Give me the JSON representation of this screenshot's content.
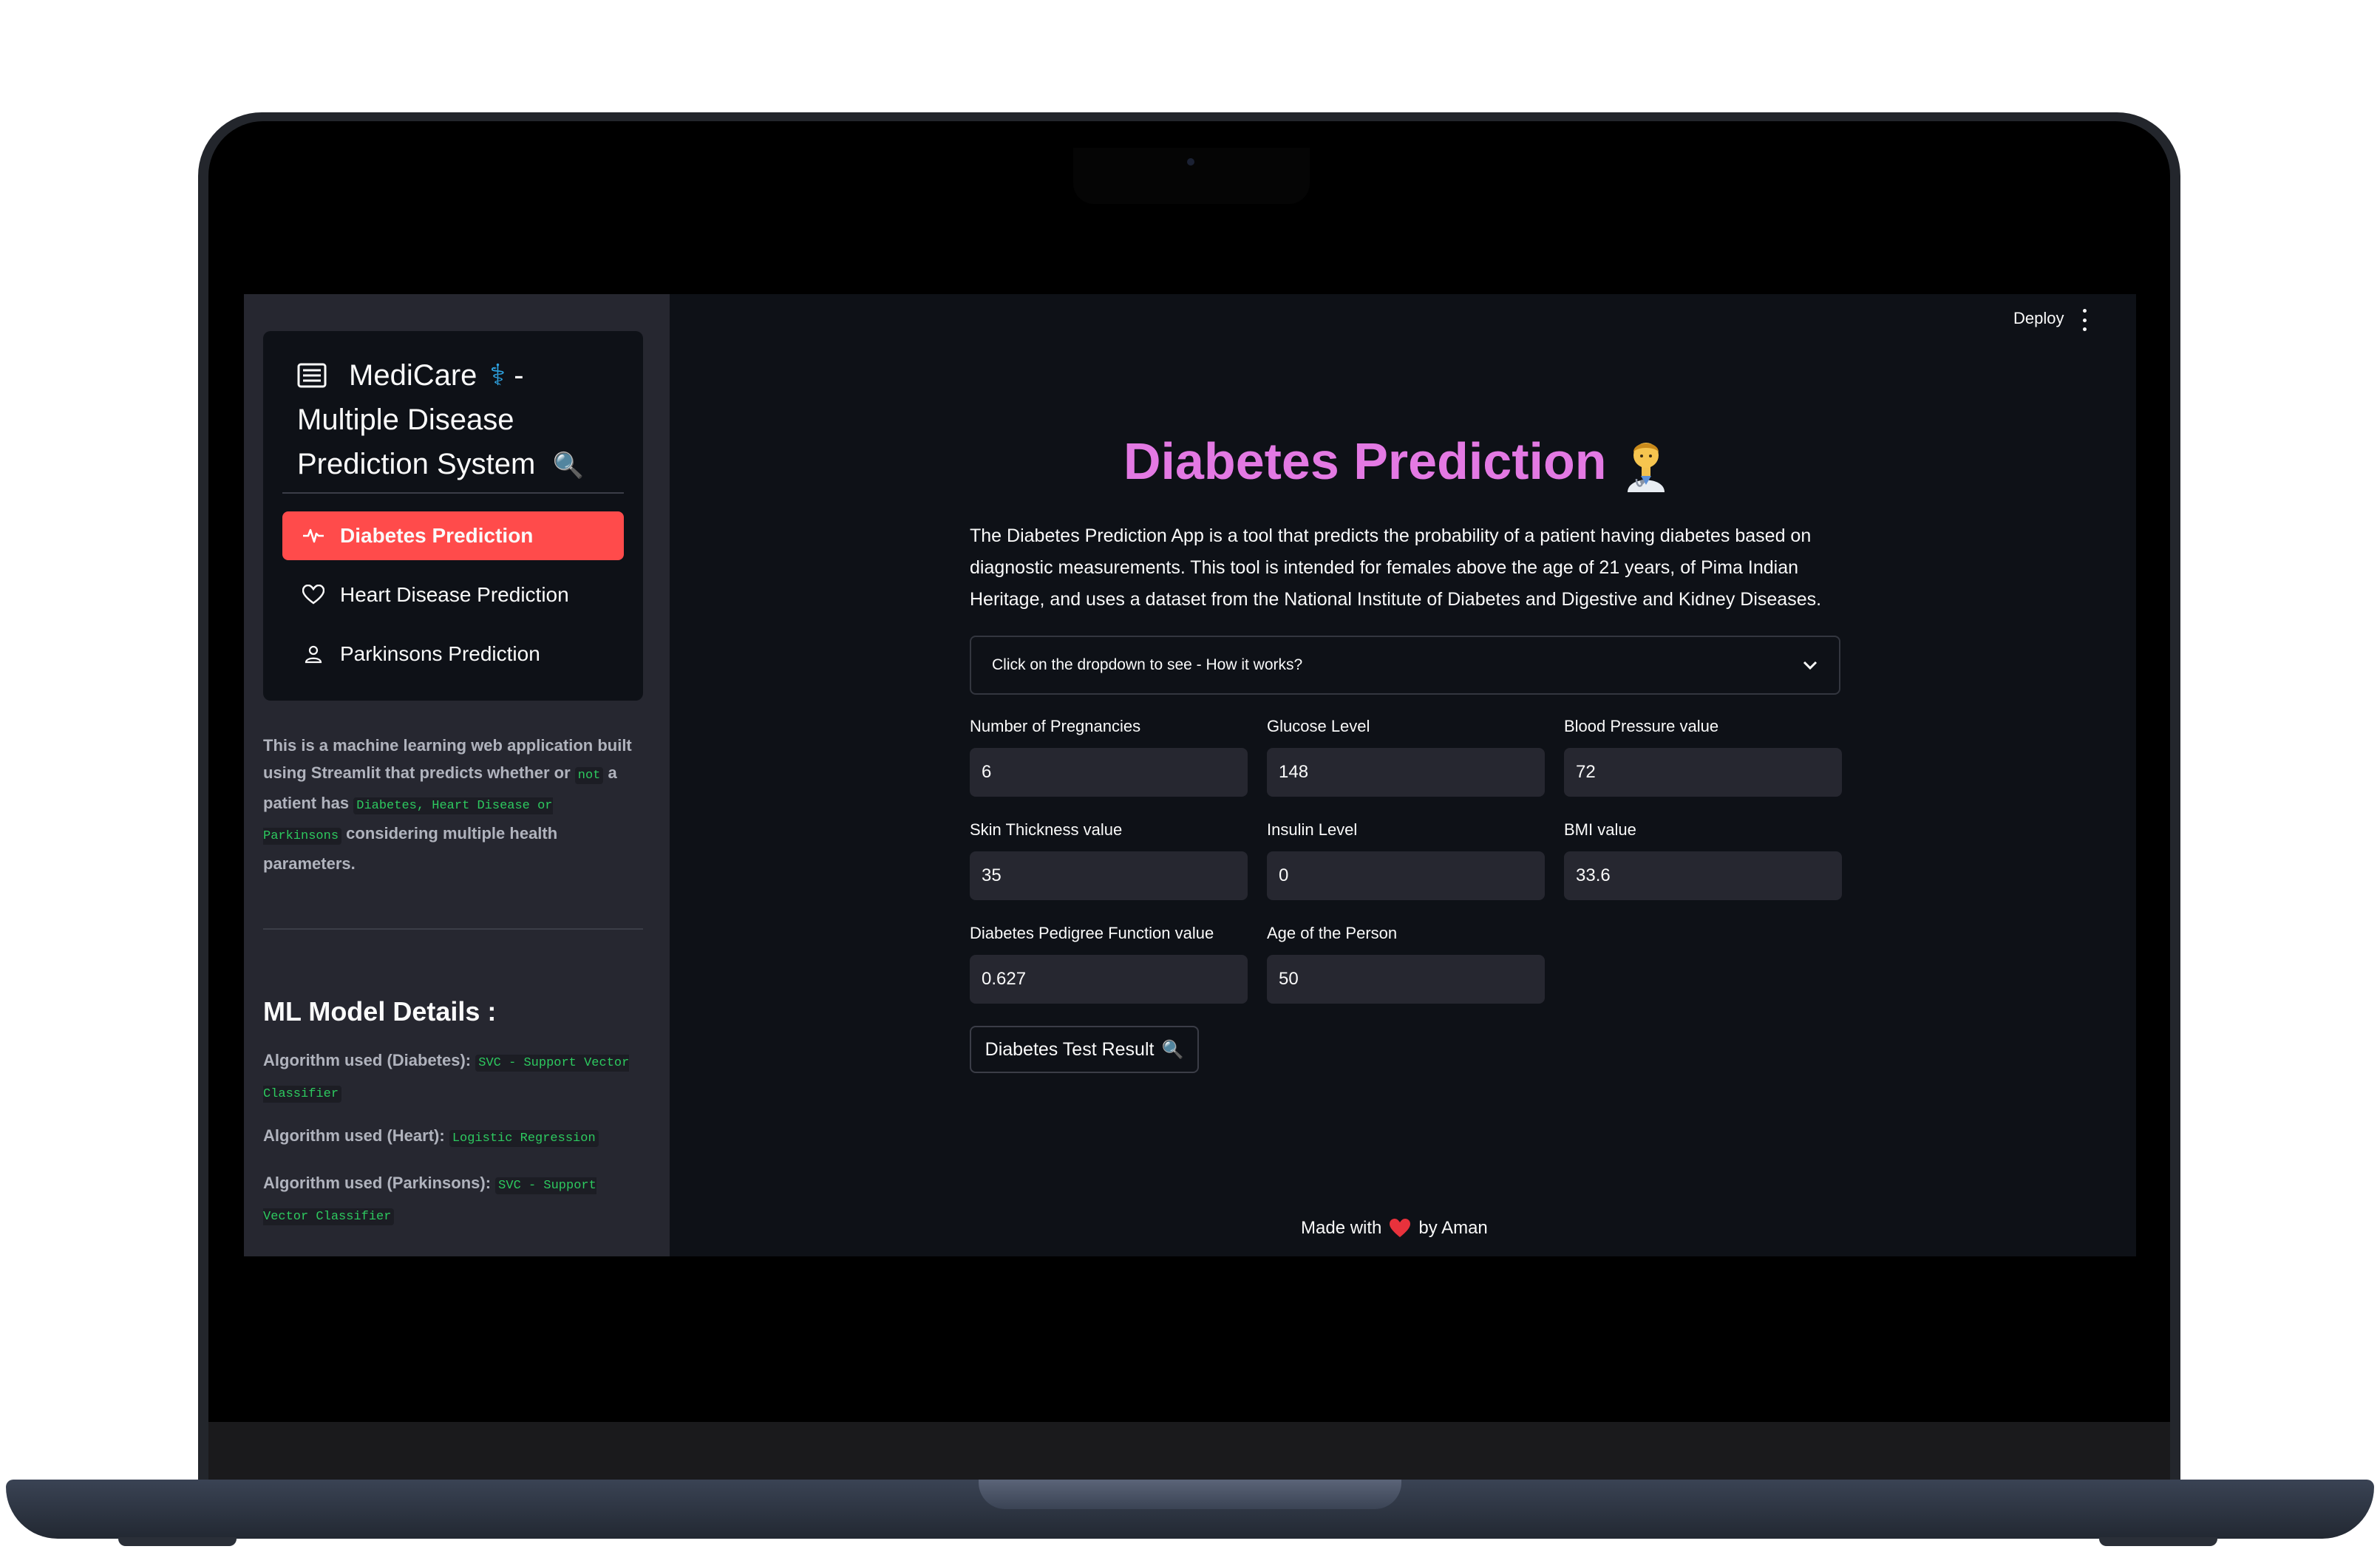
{
  "header": {
    "deploy_label": "Deploy"
  },
  "sidebar": {
    "menu_title_line1": "MediCare",
    "menu_title_dash": "-",
    "menu_title_line2": "Multiple Disease",
    "menu_title_line3": "Prediction System",
    "caduceus_glyph": "⚕",
    "magnifier_glyph": "🔍",
    "items": [
      {
        "label": "Diabetes Prediction",
        "icon": "activity-icon",
        "active": true
      },
      {
        "label": "Heart Disease Prediction",
        "icon": "heart-icon",
        "active": false
      },
      {
        "label": "Parkinsons Prediction",
        "icon": "person-icon",
        "active": false
      }
    ],
    "description": {
      "part1": "This is a machine learning web application built using Streamlit that predicts whether or ",
      "code_not": "not",
      "part2": " a patient has ",
      "code_diseases": "Diabetes, Heart Disease or Parkinsons",
      "part3": " considering multiple health parameters."
    },
    "ml_heading": "ML Model Details :",
    "algorithms": [
      {
        "label": "Algorithm used (Diabetes):",
        "model": "SVC - Support Vector Classifier"
      },
      {
        "label": "Algorithm used (Heart):",
        "model": "Logistic Regression"
      },
      {
        "label": "Algorithm used (Parkinsons):",
        "model": "SVC - Support Vector Classifier"
      }
    ]
  },
  "main": {
    "title": "Diabetes Prediction",
    "intro": "The Diabetes Prediction App is a tool that predicts the probability of a patient having diabetes based on diagnostic measurements. This tool is intended for females above the age of 21 years, of Pima Indian Heritage, and uses a dataset from the National Institute of Diabetes and Digestive and Kidney Diseases.",
    "expander_label": "Click on the dropdown to see - How it works?",
    "fields": [
      {
        "label": "Number of Pregnancies",
        "value": "6"
      },
      {
        "label": "Glucose Level",
        "value": "148"
      },
      {
        "label": "Blood Pressure value",
        "value": "72"
      },
      {
        "label": "Skin Thickness value",
        "value": "35"
      },
      {
        "label": "Insulin Level",
        "value": "0"
      },
      {
        "label": "BMI value",
        "value": "33.6"
      },
      {
        "label": "Diabetes Pedigree Function value",
        "value": "0.627"
      },
      {
        "label": "Age of the Person",
        "value": "50"
      }
    ],
    "result_button_label": "Diabetes Test Result",
    "result_button_glyph": "🔍"
  },
  "footer": {
    "made_with": "Made with",
    "by": "by Aman"
  },
  "colors": {
    "accent": "#ff4b4b",
    "title": "#e379e3",
    "code": "#2dc95f",
    "background": "#0e1117",
    "sidebar": "#262730"
  }
}
